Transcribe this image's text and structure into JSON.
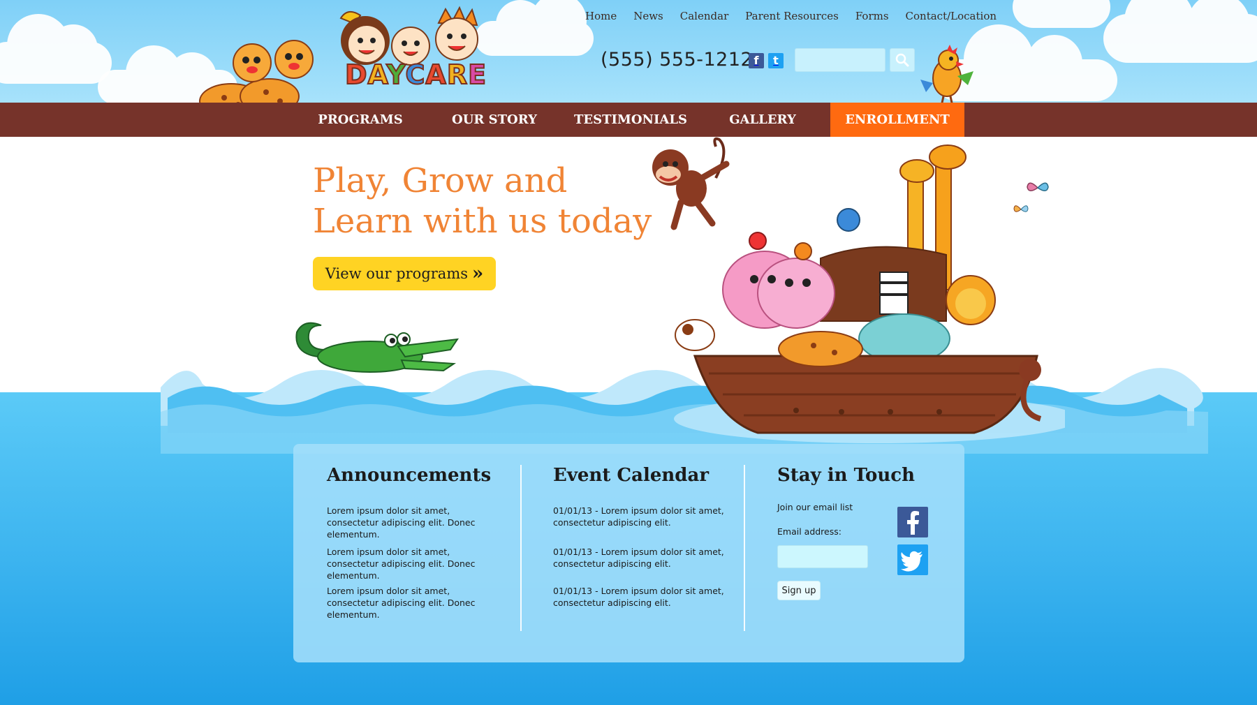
{
  "brand": {
    "logo_letters": [
      "D",
      "A",
      "Y",
      "C",
      "A",
      "R",
      "E"
    ]
  },
  "top_links": [
    "Home",
    "News",
    "Calendar",
    "Parent Resources",
    "Forms",
    "Contact/Location"
  ],
  "header": {
    "phone": "(555) 555-1212",
    "facebook_icon": "f",
    "twitter_icon": "t",
    "search_placeholder": ""
  },
  "nav": {
    "items": [
      "Programs",
      "Our Story",
      "Testimonials",
      "Gallery",
      "Enrollment"
    ],
    "active": "Enrollment"
  },
  "hero": {
    "title_line1": "Play, Grow and",
    "title_line2": "Learn with us today",
    "cta_label": "View our programs",
    "cta_arrows": "»"
  },
  "announcements": {
    "title": "Announcements",
    "items": [
      "Lorem ipsum dolor sit amet, consectetur adipiscing elit. Donec elementum.",
      "Lorem ipsum dolor sit amet, consectetur adipiscing elit. Donec elementum.",
      "Lorem ipsum dolor sit amet, consectetur adipiscing elit. Donec elementum."
    ]
  },
  "events": {
    "title": "Event Calendar",
    "items": [
      "01/01/13 - Lorem ipsum dolor sit amet, consectetur adipiscing elit.",
      "01/01/13 - Lorem ipsum dolor sit amet, consectetur adipiscing elit.",
      "01/01/13 - Lorem ipsum dolor sit amet, consectetur adipiscing elit."
    ]
  },
  "stay": {
    "title": "Stay in Touch",
    "join_text": "Join our email list",
    "email_label": "Email address:",
    "email_value": "",
    "signup_label": "Sign up"
  },
  "colors": {
    "nav_bg": "#76332a",
    "nav_active": "#ff6a10",
    "hero_text": "#f08435",
    "cta_bg": "#ffd323",
    "sky": "#8fd6f8",
    "sea": "#3bb3ef"
  },
  "icons": [
    "leopard-icon",
    "parrot-icon",
    "monkey-icon",
    "crocodile-icon",
    "noahs-ark-icon",
    "butterfly-icon",
    "search-icon",
    "facebook-icon",
    "twitter-icon"
  ]
}
